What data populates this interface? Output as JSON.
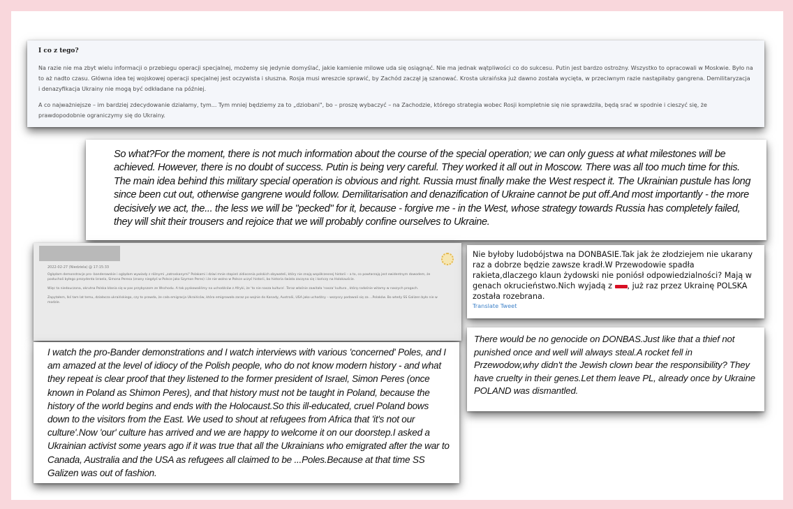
{
  "colors": {
    "page_background": "#f9d7dc",
    "canvas": "#ffffff",
    "link": "#3f82c8",
    "flag_red": "#d80f24"
  },
  "polish_article": {
    "title": "I co z tego?",
    "paragraph1": "Na razie nie ma zbyt wielu informacji o przebiegu operacji specjalnej, możemy się jedynie domyślać, jakie kamienie milowe uda się osiągnąć. Nie ma jednak wątpliwości co do sukcesu. Putin jest bardzo ostrożny. Wszystko to opracowali w Moskwie. Było na to aż nadto czasu. Główna idea tej wojskowej operacji specjalnej jest oczywista i słuszna. Rosja musi wreszcie sprawić, by Zachód zaczął ją szanować. Krosta ukraińska już dawno została wycięta, w przeciwnym razie nastąpiłaby gangrena. Demilitaryzacja i denazyfikacja Ukrainy nie mogą być odkładane na później.",
    "paragraph2": "A co najważniejsze – im bardziej zdecydowanie działamy, tym... Tym mniej będziemy za to „dziobani\", bo – proszę wybaczyć – na Zachodzie, którego strategia wobec Rosji kompletnie się nie sprawdziła, będą srać w spodnie i cieszyć się, że prawdopodobnie ograniczymy się do Ukrainy."
  },
  "translation_1": {
    "text": "So what?For the moment, there is not much information about the course of the special operation; we can only guess at what milestones will be achieved. However, there is no doubt of success. Putin is being very careful. They worked it all out in Moscow. There was all too much time for this. The main idea behind this military special operation is obvious and right. Russia must finally make the West respect it. The Ukrainian pustule has long since been cut out, otherwise gangrene would follow. Demilitarisation and denazification of Ukraine cannot be put off.And most importantly - the more decisively we act, the... the less we will be \"pecked\" for it, because - forgive me - in the West, whose strategy towards Russia has completely failed, they will shit their trousers and rejoice that we will probably confine ourselves to Ukraine."
  },
  "forum_comment": {
    "meta": "2022-02-27 (Niedziela) @ 17:15:33",
    "p1": "Oglądam demonstracje pro- banderowskie i oglądam wywiady z różnymi „zatroskanymi\" Polakami i dziwi mnie stopień zidiocenia polskich obywateli, który nie znają współczesnej historii – a to, co powtarzają jest ewidentnym dowodem, że posłuchali byłego prezydenta Izraela, Simona Peresa (znany niegdyś w Polsce jako Szymon Peres) i że nie wolno w Polsce uczyć historii, bo historia świata zaczyna się i kończy na Holokauście.",
    "p2": "Więc ta niedouczona, okrutna Polska kłania się w pas przybyszom ze Wschodu. A tak pyskowaliśmy na uchodźców z Afryki, że 'to nie nasza kultura'. Teraz właśnie zawitała 'nasza' kultura , którą radośnie witamy w naszych progach.",
    "p3": "Zapytałem, lkś tam lat temu, działacza ukraińskiego, czy to prawda, że cała emigracja Ukraińców, która emigrowała zaraz po wojnie do Kanady, Australii, USA jako uchodźcy – wszyscy podawali się za ...Polaków. Bo wtedy SS Galizen było nie w modzie."
  },
  "translation_2": {
    "text": "I watch the pro-Bander demonstrations and I watch interviews with various 'concerned' Poles, and I am amazed at the level of idiocy of the Polish people, who do not know modern history - and what they repeat is clear proof that they listened to the former president of Israel, Simon Peres (once known in Poland as Shimon Peres), and that history must not be taught in Poland, because the history of the world begins and ends with the Holocaust.So this ill-educated, cruel Poland bows down to the visitors from the East. We used to shout at refugees from Africa that 'it's not our culture'.Now 'our' culture has arrived and we are happy to welcome it on our doorstep.I asked a Ukrainian activist some years ago if it was true that all the Ukrainians who emigrated after the war to Canada, Australia and the USA as refugees all claimed to be ...Poles.Because at that time SS Galizen was out of fashion."
  },
  "tweet": {
    "text_before_flag": "Nie byłoby ludobójstwa na DONBASIE.Tak jak że złodziejem nie ukarany raz a dobrze będzie zawsze kradł.W Przewodowie spadła rakieta,dlaczego klaun żydowski nie poniósł odpowiedzialności? Mają w genach okrucieństwo.Nich wyjadą z",
    "text_after_flag": ", już raz przez Ukrainę POLSKA została rozebrana.",
    "translate_label": "Translate Tweet"
  },
  "translation_3": {
    "text": "There would be no genocide on DONBAS.Just like that a thief not punished once and well will always steal.A rocket fell in Przewodow,why didn't the Jewish clown bear the responsibility? They have cruelty in their genes.Let them leave PL, already once by Ukraine POLAND was dismantled."
  }
}
